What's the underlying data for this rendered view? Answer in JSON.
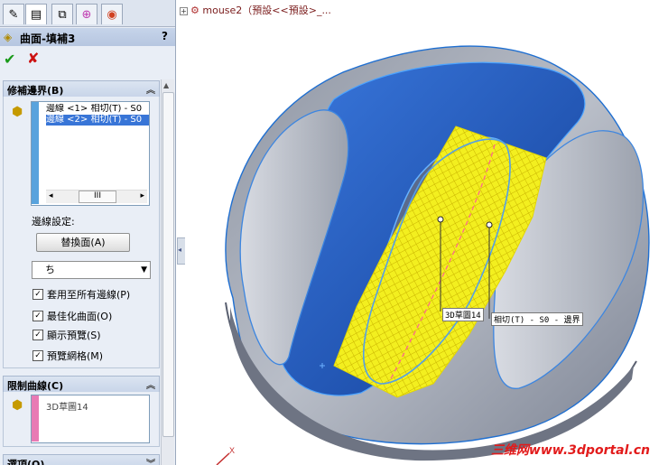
{
  "tree": {
    "node_label": "mouse2（預設<<預設>_..."
  },
  "pm": {
    "title": "曲面-填補3",
    "help": "?",
    "groups": {
      "boundary": {
        "title": "修補邊界(B)",
        "items": [
          "邊線 <1> 相切(T) - S0",
          "邊線 <2> 相切(T) - S0"
        ],
        "scroll_thumb": "III",
        "edge_settings_label": "邊線設定:",
        "replace_button": "替換面(A)",
        "dropdown_value": "ち",
        "checks": [
          {
            "label": "套用至所有邊線(P)",
            "checked": true
          },
          {
            "label": "最佳化曲面(O)",
            "checked": true
          },
          {
            "label": "顯示預覽(S)",
            "checked": true
          },
          {
            "label": "預覽網格(M)",
            "checked": true
          }
        ]
      },
      "constraint": {
        "title": "限制曲線(C)",
        "items": [
          "3D草圖14"
        ]
      },
      "options": {
        "title": "選項(O)"
      }
    }
  },
  "viewport": {
    "callout_sketch": "3D草圖14",
    "callout_tangent": "相切(T) - S0 - 邊界",
    "axis_x": "X"
  },
  "watermark": "三维网www.3dportal.cn",
  "colors": {
    "surface_gray": "#9aa0ad",
    "highlight_blue": "#1f5fc4",
    "preview_yellow": "#f2ee1e"
  }
}
